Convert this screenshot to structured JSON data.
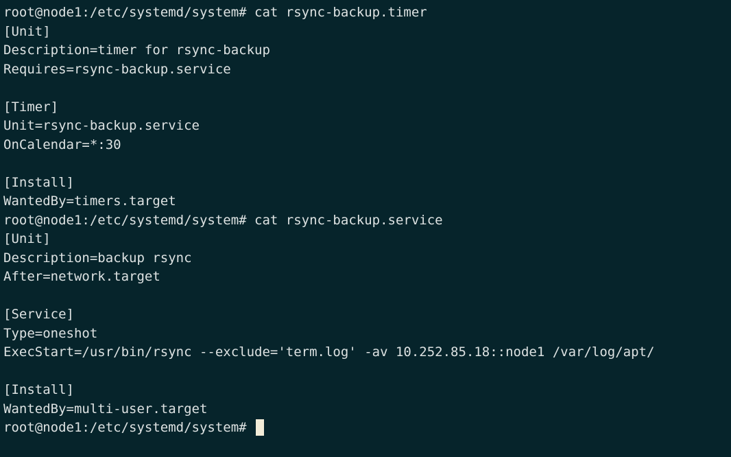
{
  "terminal": {
    "background": "#06242b",
    "foreground": "#dde2e2",
    "cursor_color": "#f2ecd8",
    "lines": [
      "root@node1:/etc/systemd/system# cat rsync-backup.timer",
      "[Unit]",
      "Description=timer for rsync-backup",
      "Requires=rsync-backup.service",
      "",
      "[Timer]",
      "Unit=rsync-backup.service",
      "OnCalendar=*:30",
      "",
      "[Install]",
      "WantedBy=timers.target",
      "root@node1:/etc/systemd/system# cat rsync-backup.service",
      "[Unit]",
      "Description=backup rsync",
      "After=network.target",
      "",
      "[Service]",
      "Type=oneshot",
      "ExecStart=/usr/bin/rsync --exclude='term.log' -av 10.252.85.18::node1 /var/log/apt/",
      "",
      "[Install]",
      "WantedBy=multi-user.target"
    ],
    "prompt": "root@node1:/etc/systemd/system# "
  }
}
